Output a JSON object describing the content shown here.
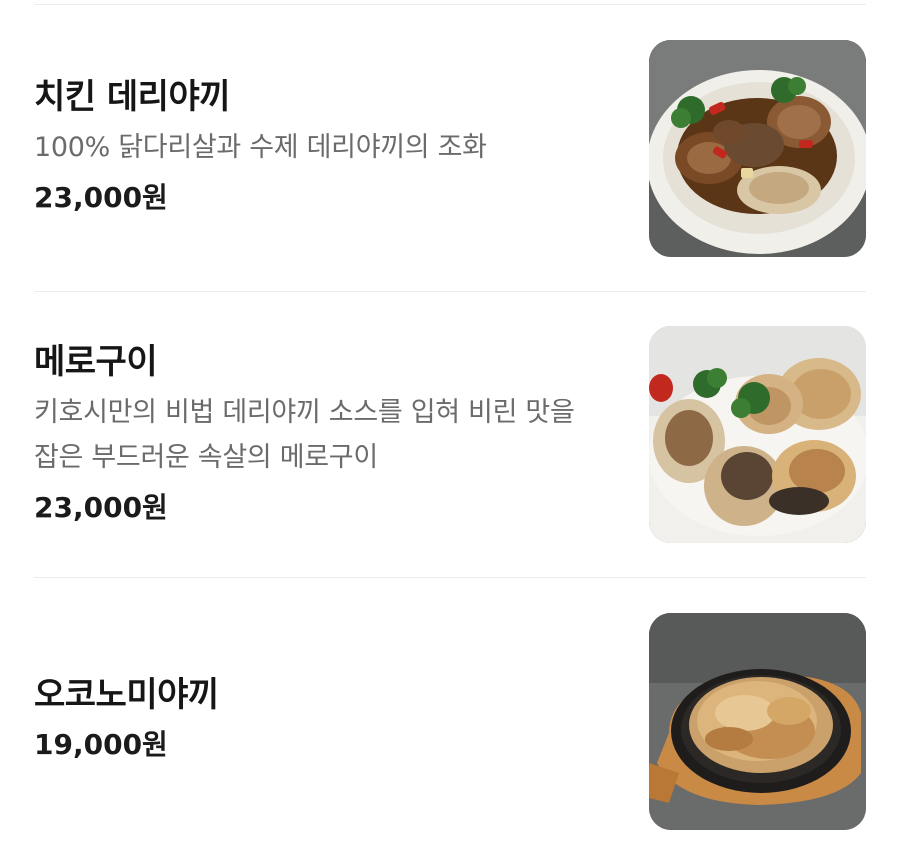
{
  "menu": {
    "items": [
      {
        "name": "치킨 데리야끼",
        "description": [
          "100% 닭다리살과 수제 데리야끼의 조화"
        ],
        "price": "23,000원",
        "photo_icon": "chicken-teriyaki-photo"
      },
      {
        "name": "메로구이",
        "description": [
          "키호시만의 비법 데리야끼 소스를 입혀 비린 맛을",
          "잡은 부드러운 속살의 메로구이"
        ],
        "price": "23,000원",
        "photo_icon": "grilled-mero-photo"
      },
      {
        "name": "오코노미야끼",
        "description": [],
        "price": "19,000원",
        "photo_icon": "okonomiyaki-photo"
      }
    ]
  },
  "colors": {
    "title": "#161616",
    "description": "#6b6b6b",
    "divider": "#ececec"
  }
}
